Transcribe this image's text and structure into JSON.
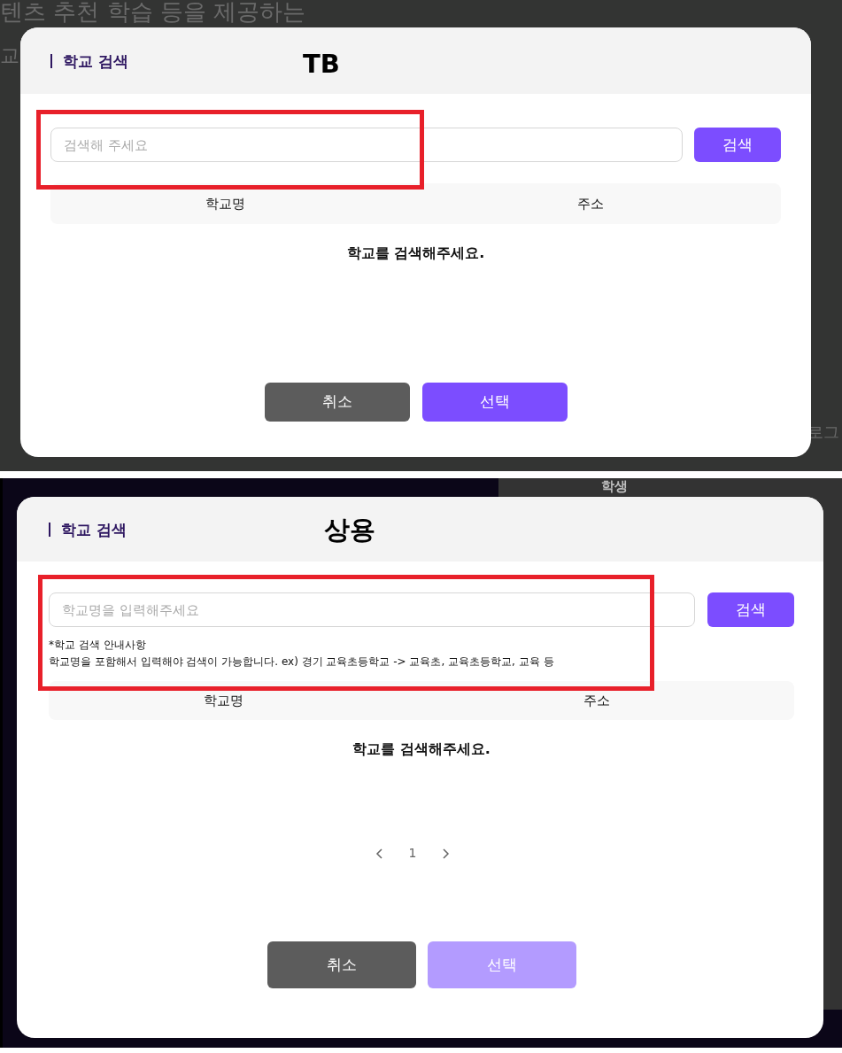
{
  "panels": [
    {
      "background_texts": [
        "텐츠 추천 학습 등을 제공하는",
        "교",
        "로그"
      ],
      "annotation": {
        "label": "TB",
        "highlight": true
      },
      "dialog": {
        "title": "학교 검색",
        "search": {
          "placeholder": "검색해 주세요",
          "button": "검색"
        },
        "columns": [
          "학교명",
          "주소"
        ],
        "empty_message": "학교를 검색해주세요.",
        "buttons": [
          {
            "label": "취소",
            "kind": "cancel",
            "disabled": false
          },
          {
            "label": "선택",
            "kind": "confirm",
            "disabled": false
          }
        ]
      }
    },
    {
      "background_texts": [
        "학생"
      ],
      "annotation": {
        "label": "상용",
        "highlight": true
      },
      "dialog": {
        "title": "학교 검색",
        "search": {
          "placeholder": "학교명을 입력해주세요",
          "button": "검색"
        },
        "notes": [
          "*학교 검색 안내사항",
          "학교명을 포함해서 입력해야 검색이 가능합니다. ex) 경기 교육초등학교 -> 교육초, 교육초등학교, 교육 등"
        ],
        "columns": [
          "학교명",
          "주소"
        ],
        "empty_message": "학교를 검색해주세요.",
        "pagination": {
          "pages": [
            "1"
          ]
        },
        "buttons": [
          {
            "label": "취소",
            "kind": "cancel",
            "disabled": false
          },
          {
            "label": "선택",
            "kind": "confirm",
            "disabled": true
          }
        ]
      }
    }
  ]
}
